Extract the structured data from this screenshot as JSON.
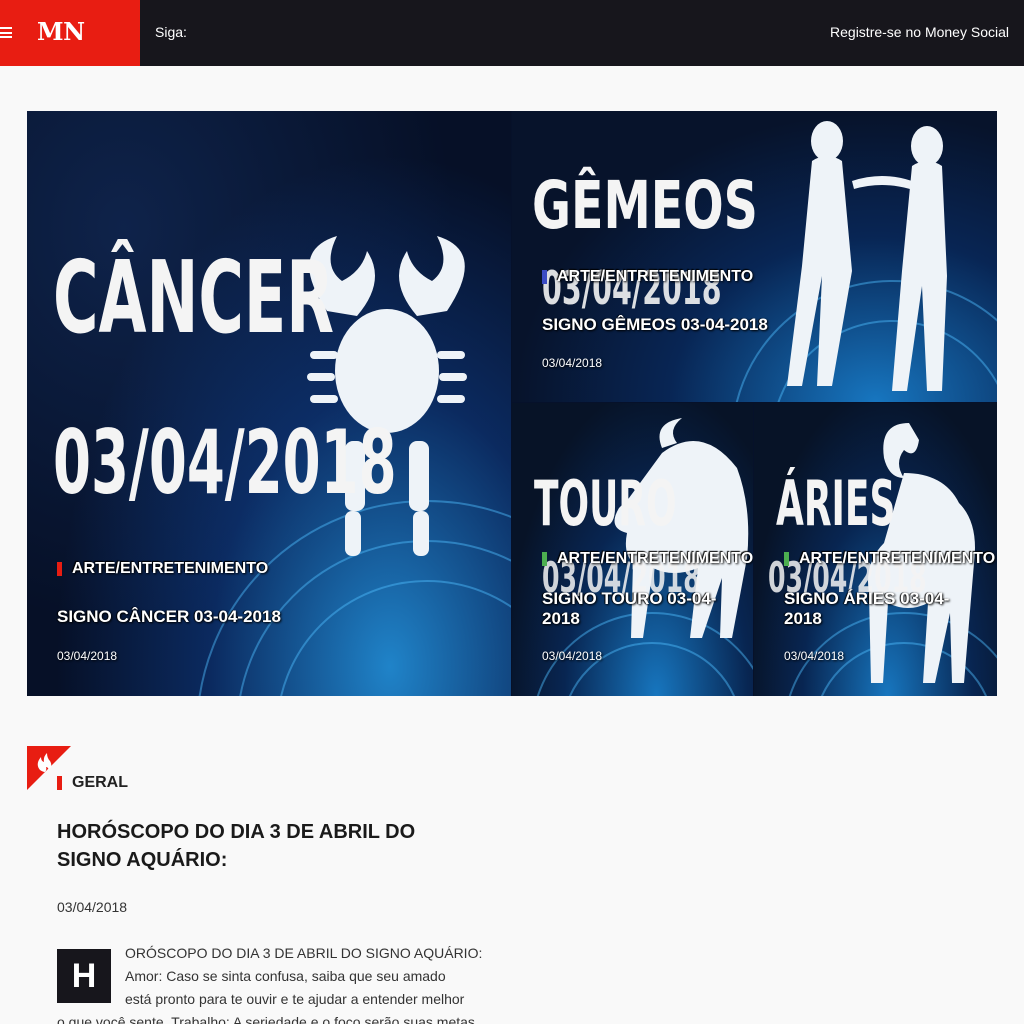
{
  "header": {
    "logo": "MN",
    "follow_label": "Siga:",
    "register_link": "Registre-se no Money Social",
    "brand_color": "#e81d12"
  },
  "featured": [
    {
      "image_word": "CÂNCER",
      "image_date": "03/04/2018",
      "category": "ARTE/ENTRETENIMENTO",
      "category_color": "#e81d12",
      "title": "SIGNO CÂNCER 03-04-2018",
      "date": "03/04/2018"
    },
    {
      "image_word": "GÊMEOS",
      "image_date": "03/04/2018",
      "category": "ARTE/ENTRETENIMENTO",
      "category_color": "#3b4cc4",
      "title": "SIGNO GÊMEOS 03-04-2018",
      "date": "03/04/2018"
    },
    {
      "image_word": "TOURO",
      "image_date": "03/04/2018",
      "category": "ARTE/ENTRETENIMENTO",
      "category_color": "#4caf50",
      "title": "SIGNO TOURO 03-04-2018",
      "date": "03/04/2018"
    },
    {
      "image_word": "ÁRIES",
      "image_date": "03/04/2018",
      "category": "ARTE/ENTRETENIMENTO",
      "category_color": "#4caf50",
      "title": "SIGNO ÁRIES 03-04-2018",
      "date": "03/04/2018"
    }
  ],
  "article": {
    "badge_icon": "fire-icon",
    "category": "GERAL",
    "title": "HORÓSCOPO DO DIA 3 DE ABRIL DO SIGNO AQUÁRIO:",
    "date": "03/04/2018",
    "drop_cap": "H",
    "body_lines": [
      "ORÓSCOPO DO DIA 3 DE ABRIL DO SIGNO AQUÁRIO:",
      "Amor: Caso se sinta confusa, saiba que seu amado",
      "está pronto para te ouvir e te ajudar a entender melhor",
      "o que você sente. Trabalho: A seriedade e o foco serão suas metas"
    ]
  }
}
